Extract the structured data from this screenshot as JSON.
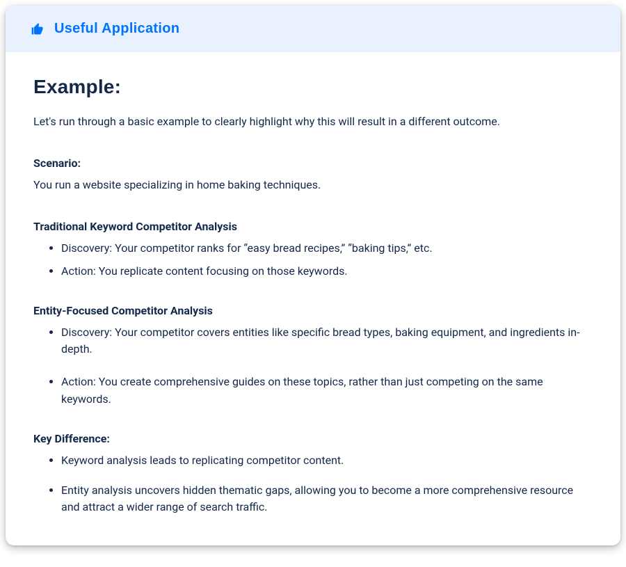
{
  "header": {
    "icon": "thumbs-up-icon",
    "title": "Useful Application"
  },
  "body": {
    "example_heading": "Example:",
    "intro": "Let's run through a basic example to clearly highlight why this will result in a different outcome.",
    "scenario": {
      "label": "Scenario:",
      "text": "You run a website specializing in home baking techniques."
    },
    "traditional": {
      "label": "Traditional Keyword Competitor Analysis",
      "items": [
        "Discovery: Your competitor ranks for “easy bread recipes,” “baking tips,” etc.",
        "Action: You replicate content focusing on those keywords."
      ]
    },
    "entity": {
      "label": "Entity-Focused Competitor Analysis",
      "items": [
        "Discovery: Your competitor covers entities like specific bread types, baking equipment, and ingredients in-depth.",
        "Action: You create comprehensive guides on these topics, rather than just competing on the same keywords."
      ]
    },
    "key_difference": {
      "label": "Key Difference:",
      "items": [
        "Keyword analysis leads to replicating competitor content.",
        "Entity analysis uncovers hidden thematic gaps, allowing you to become a more comprehensive resource and attract a wider range of search traffic."
      ]
    }
  }
}
